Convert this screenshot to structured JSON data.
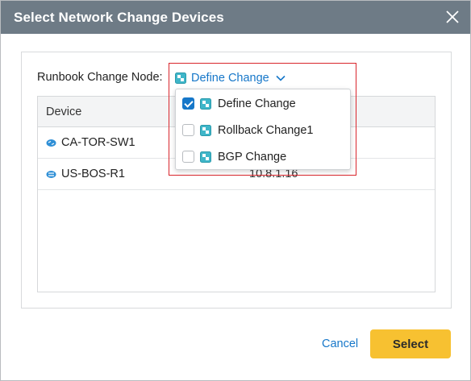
{
  "dialog": {
    "title": "Select Network Change Devices",
    "close_icon": "close-icon"
  },
  "runbook_node": {
    "label": "Runbook Change Node:",
    "selected": "Define Change",
    "icon": "change-node-icon",
    "chevron_icon": "chevron-down-icon",
    "options": [
      {
        "label": "Define Change",
        "checked": true
      },
      {
        "label": "Rollback Change1",
        "checked": false
      },
      {
        "label": "BGP Change",
        "checked": false
      }
    ]
  },
  "table": {
    "columns": [
      "Device"
    ],
    "rows": [
      {
        "device": "CA-TOR-SW1",
        "ip": "",
        "icon": "switch-icon"
      },
      {
        "device": "US-BOS-R1",
        "ip": "10.8.1.16",
        "icon": "router-icon"
      }
    ]
  },
  "footer": {
    "cancel_label": "Cancel",
    "select_label": "Select"
  },
  "colors": {
    "titlebar": "#6e7b86",
    "link": "#1677c9",
    "primary_button": "#f7c131",
    "highlight": "#d9252c"
  }
}
